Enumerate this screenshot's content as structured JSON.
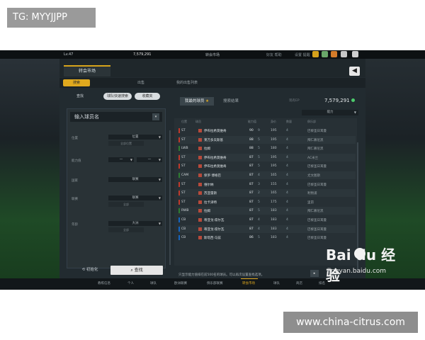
{
  "watermarks": {
    "tg": "TG: MYYJJPP",
    "site": "www.china-citrus.com",
    "baidu_logo": "Bai du 经验",
    "baidu_url": "jingyan.baidu.com"
  },
  "topbar": {
    "level": "Lv.47",
    "coins": "7,579,291",
    "title": "转会市场",
    "right1": "好友 帮助",
    "right2": "设置 提醒"
  },
  "panel": {
    "main_tab": "转会市场",
    "back_icon": "back-icon",
    "subtabs": [
      "搜索",
      "出售",
      "我的出售列表"
    ]
  },
  "left": {
    "btn_search": "查找",
    "btn_quick": "球队快速搜索",
    "btn_fav": "收藏夹",
    "name_input": "输入球员名",
    "filters": [
      {
        "label": "位置",
        "value": "位置",
        "sub": "全部位置"
      },
      {
        "label": "能力值",
        "value": "一",
        "value2": "一"
      },
      {
        "label": "国家",
        "value": "联赛"
      },
      {
        "label": "联赛",
        "value": "联赛",
        "sub": "全部"
      },
      {
        "label": "年龄",
        "value": "大洲",
        "sub": "全部"
      }
    ],
    "reset": "初始化",
    "search": "查找"
  },
  "right": {
    "tab_active": "我最的球员",
    "tab_other": "搜索结果",
    "coins_label": "现有EP",
    "coins": "7,579,291",
    "sort": "能力",
    "headers": [
      "位置",
      "球员",
      "能力值",
      "身价",
      "数量",
      "俱乐部"
    ],
    "rows": [
      {
        "pos": "ST",
        "color": "#c0392b",
        "name": "伊布拉希莫维奇",
        "ovr": "90",
        "g": "9",
        "val": "195",
        "r4": "4",
        "club": "巴黎圣日耳曼"
      },
      {
        "pos": "ST",
        "color": "#c0392b",
        "name": "莱万多夫斯基",
        "ovr": "88",
        "g": "5",
        "val": "195",
        "r4": "4",
        "club": "拜仁慕尼黑"
      },
      {
        "pos": "LWB",
        "color": "#2e7d32",
        "name": "拉姆",
        "ovr": "88",
        "g": "5",
        "val": "180",
        "r4": "4",
        "club": "拜仁慕尼黑"
      },
      {
        "pos": "ST",
        "color": "#c0392b",
        "name": "伊布拉希莫维奇",
        "ovr": "87",
        "g": "5",
        "val": "195",
        "r4": "4",
        "club": "AC米兰"
      },
      {
        "pos": "ST",
        "color": "#c0392b",
        "name": "伊布拉希莫维奇",
        "ovr": "87",
        "g": "5",
        "val": "195",
        "r4": "4",
        "club": "巴黎圣日耳曼"
      },
      {
        "pos": "CAM",
        "color": "#2e7d32",
        "name": "保罗·博格巴",
        "ovr": "87",
        "g": "4",
        "val": "165",
        "r4": "4",
        "club": "尤文图斯"
      },
      {
        "pos": "ST",
        "color": "#c0392b",
        "name": "维尔纳",
        "ovr": "87",
        "g": "3",
        "val": "155",
        "r4": "4",
        "club": "巴黎圣日耳曼"
      },
      {
        "pos": "ST",
        "color": "#c0392b",
        "name": "苏亚雷斯",
        "ovr": "87",
        "g": "2",
        "val": "165",
        "r4": "4",
        "club": "利物浦"
      },
      {
        "pos": "ST",
        "color": "#c0392b",
        "name": "拉卡泽特",
        "ovr": "87",
        "g": "5",
        "val": "175",
        "r4": "4",
        "club": "里昂"
      },
      {
        "pos": "RWB",
        "color": "#2e7d32",
        "name": "拉姆",
        "ovr": "87",
        "g": "5",
        "val": "183",
        "r4": "4",
        "club": "拜仁慕尼黑"
      },
      {
        "pos": "CB",
        "color": "#1565c0",
        "name": "蒂亚戈·席尔瓦",
        "ovr": "87",
        "g": "4",
        "val": "183",
        "r4": "4",
        "club": "巴黎圣日耳曼"
      },
      {
        "pos": "CB",
        "color": "#1565c0",
        "name": "蒂亚戈·席尔瓦",
        "ovr": "87",
        "g": "4",
        "val": "183",
        "r4": "4",
        "club": "巴黎圣日耳曼"
      },
      {
        "pos": "CB",
        "color": "#1565c0",
        "name": "斯塔西·马兹",
        "ovr": "86",
        "g": "5",
        "val": "183",
        "r4": "4",
        "club": "巴黎圣日耳曼"
      }
    ],
    "note": "只显示能力值排在前500名的球员。可以再次设置查找选项。",
    "page_btn": "▸"
  },
  "bottomnav": [
    "教练信息",
    "个人",
    "球队",
    "欧洲联赛",
    "俱乐部联赛",
    "转会市场",
    "球队",
    "商店",
    "排名"
  ],
  "colors": {
    "accent": "#e0a91e",
    "coin": "#4ccb6c"
  }
}
